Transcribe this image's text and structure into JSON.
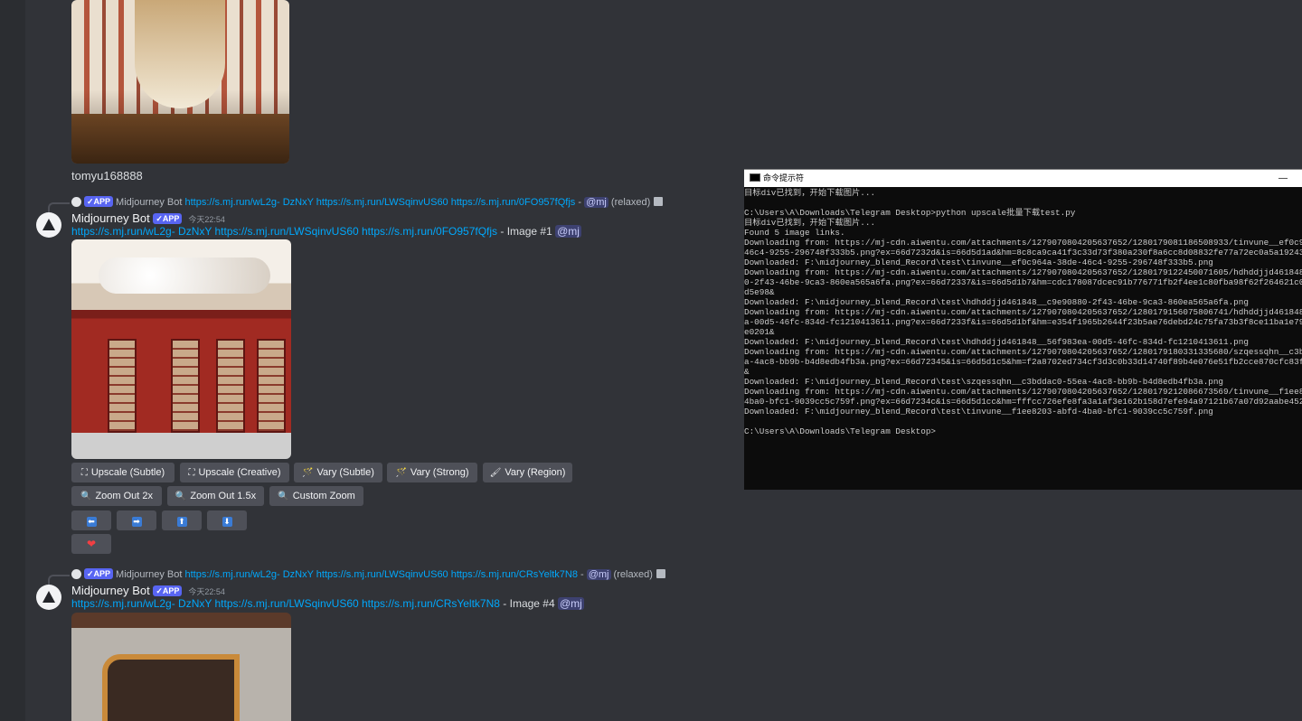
{
  "first_message": {
    "username": "tomyu168888"
  },
  "messages": [
    {
      "reply": {
        "bot": "Midjourney Bot",
        "app_badge": "✓APP",
        "links": "https://s.mj.run/wL2g- DzNxY https://s.mj.run/LWSqinvUS60 https://s.mj.run/0FO957fQfjs",
        "sep": " - ",
        "mention": "@mj",
        "mode": " (relaxed)"
      },
      "author": "Midjourney Bot",
      "app_badge": "✓APP",
      "time": "今天22:54",
      "links": "https://s.mj.run/wL2g- DzNxY https://s.mj.run/LWSqinvUS60 https://s.mj.run/0FO957fQfjs",
      "suffix": " - Image #1 ",
      "mention": "@mj"
    },
    {
      "reply": {
        "bot": "Midjourney Bot",
        "app_badge": "✓APP",
        "links": "https://s.mj.run/wL2g- DzNxY https://s.mj.run/LWSqinvUS60 https://s.mj.run/CRsYeltk7N8",
        "sep": " - ",
        "mention": "@mj",
        "mode": " (relaxed)"
      },
      "author": "Midjourney Bot",
      "app_badge": "✓APP",
      "time": "今天22:54",
      "links": "https://s.mj.run/wL2g- DzNxY https://s.mj.run/LWSqinvUS60 https://s.mj.run/CRsYeltk7N8",
      "suffix": " - Image #4 ",
      "mention": "@mj"
    }
  ],
  "buttons": {
    "row1": [
      {
        "icon": "⛶",
        "label": "Upscale (Subtle)"
      },
      {
        "icon": "⛶",
        "label": "Upscale (Creative)"
      },
      {
        "icon": "🪄",
        "label": "Vary (Subtle)"
      },
      {
        "icon": "🪄",
        "label": "Vary (Strong)"
      },
      {
        "icon": "🖌",
        "label": "Vary (Region)"
      }
    ],
    "row2": [
      {
        "icon": "🔍",
        "label": "Zoom Out 2x"
      },
      {
        "icon": "🔍",
        "label": "Zoom Out 1.5x"
      },
      {
        "icon": "🔍",
        "label": "Custom Zoom"
      }
    ],
    "pan": [
      "⬅",
      "➡",
      "⬆",
      "⬇"
    ],
    "heart": "❤"
  },
  "terminal": {
    "title": "命令提示符",
    "minimize": "—",
    "lines": [
      "目标div已找到，开始下载图片...",
      "",
      "C:\\Users\\A\\Downloads\\Telegram Desktop>python upscale批量下载test.py",
      "目标div已找到，开始下载图片...",
      "Found 5 image links.",
      "Downloading from: https://mj-cdn.aiwentu.com/attachments/1279070804205637652/1280179081186508933/tinvune__ef0c9",
      "46c4-9255-296748f333b5.png?ex=66d7232d&is=66d5d1ad&hm=8c8ca9ca41f3c33d73f380a230f8a6cc8d08832fe77a72ec0a5a19243",
      "Downloaded: F:\\midjourney_blend_Record\\test\\tinvune__ef0c964a-38de-46c4-9255-296748f333b5.png",
      "Downloading from: https://mj-cdn.aiwentu.com/attachments/1279070804205637652/1280179122450071605/hdhddjjd461848",
      "0-2f43-46be-9ca3-860ea565a6fa.png?ex=66d72337&is=66d5d1b7&hm=cdc178087dcec91b776771fb2f4ee1c80fba98f62f264621c0",
      "d5e98&",
      "Downloaded: F:\\midjourney_blend_Record\\test\\hdhddjjd461848__c9e90880-2f43-46be-9ca3-860ea565a6fa.png",
      "Downloading from: https://mj-cdn.aiwentu.com/attachments/1279070804205637652/1280179156075806741/hdhddjjd461848",
      "a-00d5-46fc-834d-fc1210413611.png?ex=66d7233f&is=66d5d1bf&hm=e354f1965b2644f23b5ae76debd24c75fa73b3f8ce11ba1e79",
      "e0201&",
      "Downloaded: F:\\midjourney_blend_Record\\test\\hdhddjjd461848__56f983ea-00d5-46fc-834d-fc1210413611.png",
      "Downloading from: https://mj-cdn.aiwentu.com/attachments/1279070804205637652/1280179180331335680/szqessqhn__c3b",
      "a-4ac8-bb9b-b4d8edb4fb3a.png?ex=66d72345&is=66d5d1c5&hm=f2a8702ed734cf3d3c0b33d14740f89b4e076e51fb2cce870cfc83f",
      "&",
      "Downloaded: F:\\midjourney_blend_Record\\test\\szqessqhn__c3bddac0-55ea-4ac8-bb9b-b4d8edb4fb3a.png",
      "Downloading from: https://mj-cdn.aiwentu.com/attachments/1279070804205637652/1280179212086673569/tinvune__f1ee8",
      "4ba0-bfc1-9039cc5c759f.png?ex=66d7234c&is=66d5d1cc&hm=fffcc726efe8fa3a1af3e162b158d7efe94a97121b67a07d92aabe452",
      "Downloaded: F:\\midjourney_blend_Record\\test\\tinvune__f1ee8203-abfd-4ba0-bfc1-9039cc5c759f.png",
      "",
      "C:\\Users\\A\\Downloads\\Telegram Desktop>"
    ]
  }
}
